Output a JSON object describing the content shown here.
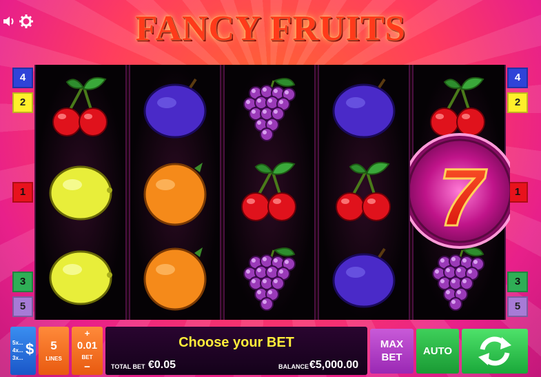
{
  "title": "FANCY FRUITS",
  "icons": {
    "sound": "speaker-icon",
    "settings": "gear-icon"
  },
  "paylines": {
    "left": [
      "4",
      "2",
      "1",
      "3",
      "5"
    ],
    "right": [
      "4",
      "2",
      "1",
      "3",
      "5"
    ],
    "colors": {
      "1": "#e8121c",
      "2": "#fff02a",
      "3": "#2fae56",
      "4": "#2f43d8",
      "5": "#a77bd6"
    }
  },
  "reels": [
    [
      "cherry",
      "lemon",
      "lemon"
    ],
    [
      "plum",
      "orange",
      "orange"
    ],
    [
      "grapes",
      "cherry",
      "grapes"
    ],
    [
      "plum",
      "cherry",
      "plum"
    ],
    [
      "cherry",
      "seven",
      "grapes"
    ]
  ],
  "feature_symbol": "7",
  "controls": {
    "paytable": {
      "lines": [
        "5x...",
        "4x...",
        "3x..."
      ],
      "icon": "dollar-icon"
    },
    "lines": {
      "value": "5",
      "label": "LINES"
    },
    "bet": {
      "plus": "+",
      "value": "0.01",
      "label": "BET",
      "minus": "−"
    },
    "message": "Choose your BET",
    "total_bet": {
      "label": "TOTAL BET",
      "value": "€0.05"
    },
    "balance": {
      "label": "BALANCE",
      "value": "€5,000.00"
    },
    "max_bet": {
      "line1": "MAX",
      "line2": "BET"
    },
    "auto": "AUTO",
    "spin_icon": "spin-arrows-icon"
  }
}
